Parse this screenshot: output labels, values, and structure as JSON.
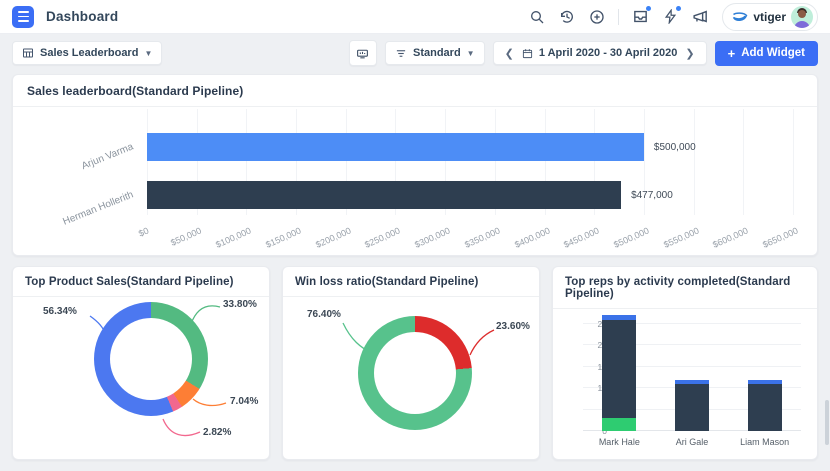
{
  "topbar": {
    "title": "Dashboard",
    "brand": "vtiger",
    "action_icons": [
      "search-icon",
      "history-icon",
      "add-record-icon",
      "inbox-icon",
      "actions-bolt-icon",
      "announcements-icon"
    ]
  },
  "toolbar": {
    "dashboard_selector": {
      "label": "Sales Leaderboard"
    },
    "view_selector": {
      "label": "Standard"
    },
    "date_range": "1 April 2020 - 30 April 2020",
    "add_widget": {
      "plus": "+",
      "label": "Add Widget"
    }
  },
  "colors": {
    "accent": "#3b6ef5",
    "bar_blue": "#4d8df6",
    "navy": "#2e3e50",
    "green": "#53ba81",
    "bright_green": "#2ecc71",
    "red": "#dd2c2c",
    "orange": "#fd7e35",
    "pink": "#f2688e",
    "donut_blue": "#4c78f0",
    "background": "#eef0f3"
  },
  "chart_data": [
    {
      "type": "bar",
      "orientation": "horizontal",
      "title": "Sales leaderboard(Standard Pipeline)",
      "categories": [
        "Arjun Varma",
        "Herman Hollerith"
      ],
      "values": [
        500000,
        477000
      ],
      "value_labels": [
        "$500,000",
        "$477,000"
      ],
      "bar_colors": [
        "#4d8df6",
        "#2e3e50"
      ],
      "xlim": [
        0,
        650000
      ],
      "x_ticks": [
        "$0",
        "$50,000",
        "$100,000",
        "$150,000",
        "$200,000",
        "$250,000",
        "$300,000",
        "$350,000",
        "$400,000",
        "$450,000",
        "$500,000",
        "$550,000",
        "$600,000",
        "$650,000"
      ],
      "grid": true
    },
    {
      "type": "pie",
      "style": "donut",
      "title": "Top Product Sales(Standard Pipeline)",
      "start_angle_deg": 0,
      "direction": "clockwise",
      "slices": [
        {
          "label": "33.80%",
          "value": 33.8,
          "color": "#53ba81"
        },
        {
          "label": "7.04%",
          "value": 7.04,
          "color": "#fd7e35"
        },
        {
          "label": "2.82%",
          "value": 2.82,
          "color": "#f2688e"
        },
        {
          "label": "56.34%",
          "value": 56.34,
          "color": "#4c78f0"
        }
      ]
    },
    {
      "type": "pie",
      "style": "donut",
      "title": "Win loss ratio(Standard Pipeline)",
      "start_angle_deg": 0,
      "direction": "clockwise",
      "slices": [
        {
          "label": "23.60%",
          "value": 23.6,
          "color": "#dd2c2c"
        },
        {
          "label": "76.40%",
          "value": 76.4,
          "color": "#57c28c"
        }
      ]
    },
    {
      "type": "bar",
      "stacked": true,
      "title": "Top reps by activity completed(Standard Pipeline)",
      "categories": [
        "Mark Hale",
        "Ari Gale",
        "Liam Mason"
      ],
      "series": [
        {
          "name": "green-segment",
          "color": "#2ecc71",
          "values": [
            3,
            0,
            0
          ]
        },
        {
          "name": "navy-segment",
          "color": "#2e3e50",
          "values": [
            23,
            11,
            11
          ]
        },
        {
          "name": "blue-segment",
          "color": "#3b72e8",
          "values": [
            1,
            1,
            1
          ]
        }
      ],
      "ylim": [
        0,
        28
      ],
      "y_ticks": [
        0,
        5,
        10,
        15,
        20,
        25
      ],
      "grid": true
    }
  ]
}
